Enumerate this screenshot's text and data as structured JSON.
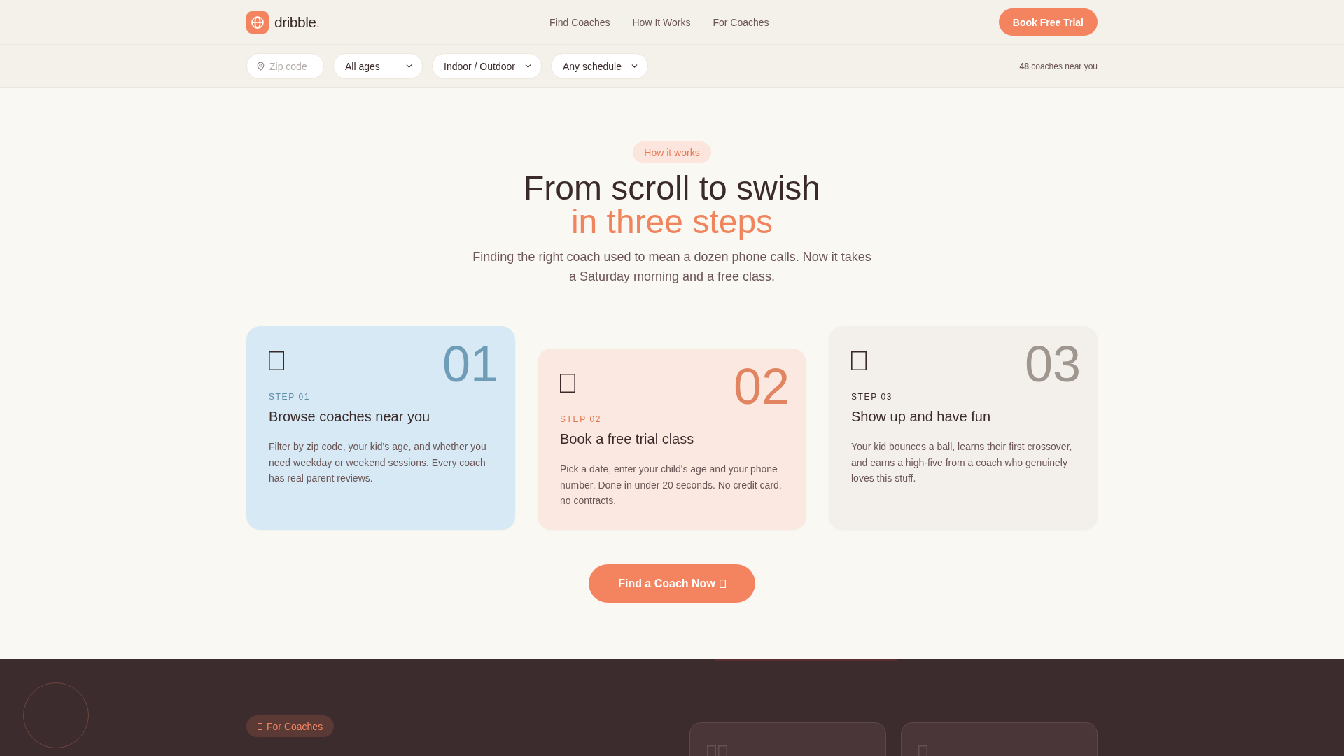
{
  "header": {
    "logo": {
      "name": "dribble",
      "accent": "."
    },
    "nav": [
      {
        "label": "Find Coaches"
      },
      {
        "label": "How It Works"
      },
      {
        "label": "For Coaches"
      }
    ],
    "cta": "Book Free Trial"
  },
  "filters": {
    "zip": {
      "placeholder": "Zip code"
    },
    "dropdowns": [
      {
        "value": "All ages"
      },
      {
        "value": "Indoor / Outdoor"
      },
      {
        "value": "Any schedule"
      }
    ],
    "result_count": "**48** coaches near you"
  },
  "how_it_works": {
    "badge": "How it works",
    "title": "From scroll to swish",
    "title_accent": "in three steps",
    "intro": "Finding the right coach used to mean a dozen phone calls. Now it takes a Saturday morning and a free class.",
    "steps": [
      {
        "kind": "sky",
        "number": "01",
        "label": "STEP 01",
        "title": "Browse coaches near you",
        "description": "Filter by zip code, your kid's age, and whether you need weekday or weekend sessions. Every coach has real parent reviews."
      },
      {
        "kind": "peach",
        "number": "02",
        "label": "STEP 02",
        "title": "Book a free trial class",
        "description": "Pick a date, enter your child's age and your phone number. Done in under 20 seconds. No credit card, no contracts."
      },
      {
        "kind": "sand",
        "number": "03",
        "label": "STEP 03",
        "title": "Show up and have fun",
        "description": "Your kid bounces a ball, learns their first crossover, and earns a high-five from a coach who genuinely loves this stuff."
      }
    ],
    "cta": "Find a Coach Now"
  },
  "for_coaches": {
    "badge": "For Coaches"
  }
}
